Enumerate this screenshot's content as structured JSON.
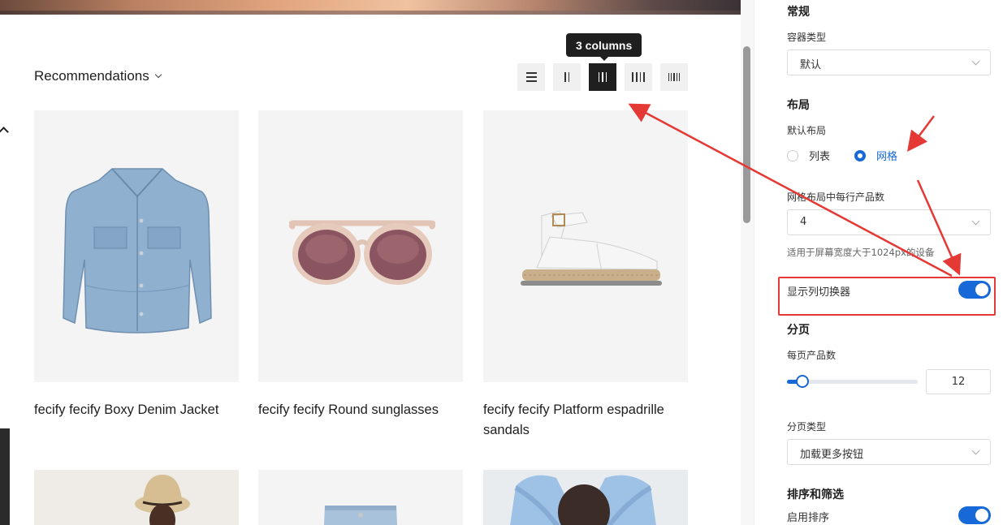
{
  "preview": {
    "sort_label": "Recommendations",
    "tooltip": "3 columns",
    "column_options": [
      "list",
      "2 columns",
      "3 columns",
      "4 columns",
      "5 columns"
    ],
    "active_columns": "3 columns",
    "products": [
      {
        "title": "fecify fecify Boxy Denim Jacket"
      },
      {
        "title": "fecify fecify Round sunglasses"
      },
      {
        "title": "fecify fecify Platform espadrille sandals"
      }
    ]
  },
  "panel": {
    "general": {
      "title": "常规",
      "container_label": "容器类型",
      "container_value": "默认"
    },
    "layout": {
      "title": "布局",
      "default_layout_label": "默认布局",
      "option_list": "列表",
      "option_grid": "网格",
      "selected": "网格",
      "per_row_label": "网格布局中每行产品数",
      "per_row_value": "4",
      "per_row_hint": "适用于屏幕宽度大于1024px的设备",
      "column_switcher_label": "显示列切换器",
      "column_switcher_on": true
    },
    "pagination": {
      "title": "分页",
      "per_page_label": "每页产品数",
      "per_page_value": "12",
      "per_page_fraction": 0.12,
      "type_label": "分页类型",
      "type_value": "加载更多按钮"
    },
    "sort_filter": {
      "title": "排序和筛选",
      "enable_sort_label": "启用排序",
      "enable_sort_on": true
    }
  },
  "colors": {
    "accent": "#1669d6",
    "annotation": "#e53935",
    "active_button": "#1f1f1f"
  }
}
